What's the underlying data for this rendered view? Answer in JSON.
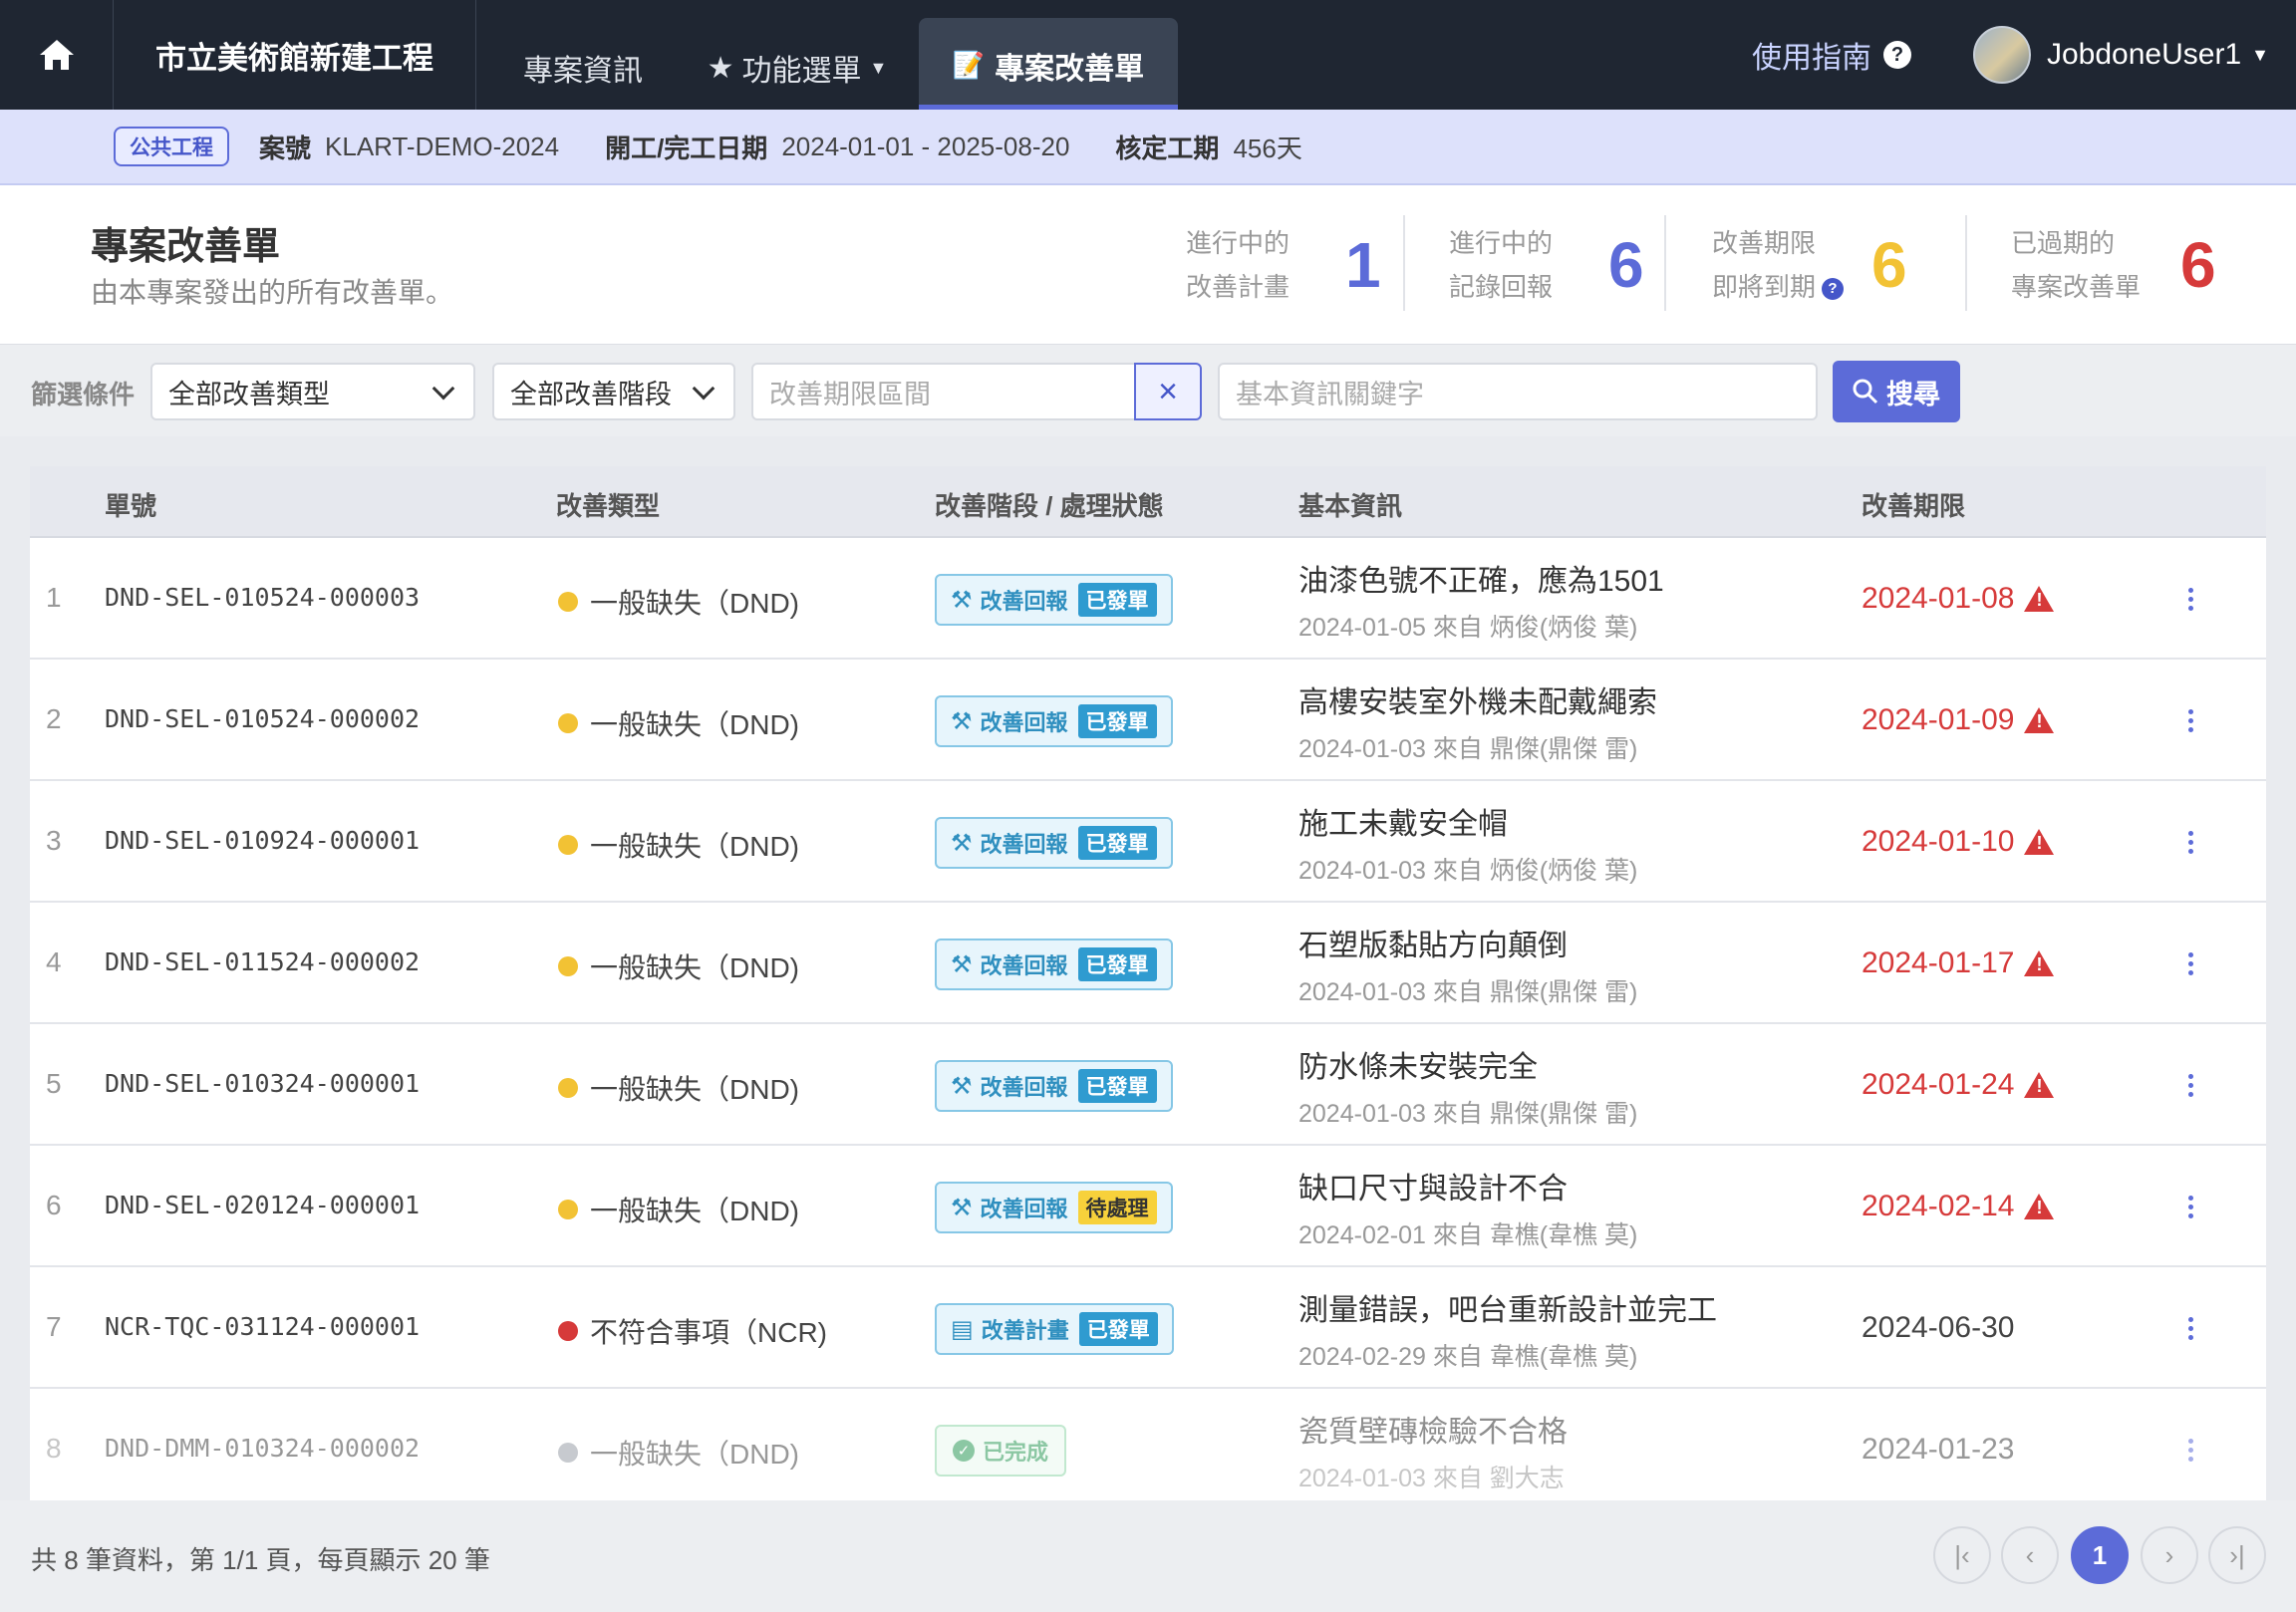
{
  "navbar": {
    "project": "市立美術館新建工程",
    "tabs": [
      {
        "label": "專案資訊",
        "icon": ""
      },
      {
        "label": "功能選單",
        "icon": "★"
      },
      {
        "label": "專案改善單",
        "icon": "📝"
      }
    ],
    "guide": "使用指南",
    "user": "JobdoneUser1"
  },
  "infobar": {
    "badge": "公共工程",
    "case_label": "案號",
    "case_value": "KLART-DEMO-2024",
    "date_label": "開工/完工日期",
    "date_value": "2024-01-01 - 2025-08-20",
    "duration_label": "核定工期",
    "duration_value": "456天"
  },
  "summary": {
    "title": "專案改善單",
    "subtitle": "由本專案發出的所有改善單。",
    "stats": [
      {
        "line1": "進行中的",
        "line2": "改善計畫",
        "value": "1",
        "color": "#5c6bd8"
      },
      {
        "line1": "進行中的",
        "line2": "記錄回報",
        "value": "6",
        "color": "#5c6bd8"
      },
      {
        "line1": "改善期限",
        "line2": "即將到期",
        "value": "6",
        "color": "#f2c234"
      },
      {
        "line1": "已過期的",
        "line2": "專案改善單",
        "value": "6",
        "color": "#d63a3a"
      }
    ]
  },
  "filters": {
    "label": "篩選條件",
    "type": "全部改善類型",
    "stage": "全部改善階段",
    "period_placeholder": "改善期限區間",
    "keyword_placeholder": "基本資訊關鍵字",
    "search": "搜尋"
  },
  "table": {
    "headers": [
      "單號",
      "改善類型",
      "改善階段 / 處理狀態",
      "基本資訊",
      "改善期限"
    ],
    "rows": [
      {
        "no": "1",
        "code": "DND-SEL-010524-000003",
        "type": "一般缺失（DND)",
        "dot": "#f2c234",
        "stage": "改善回報",
        "status": "已發單",
        "title": "油漆色號不正確，應為1501",
        "sub": "2024-01-05 來自 炳俊(炳俊 葉)",
        "deadline": "2024-01-08"
      },
      {
        "no": "2",
        "code": "DND-SEL-010524-000002",
        "type": "一般缺失（DND)",
        "dot": "#f2c234",
        "stage": "改善回報",
        "status": "已發單",
        "title": "高樓安裝室外機未配戴繩索",
        "sub": "2024-01-03 來自 鼎傑(鼎傑 雷)",
        "deadline": "2024-01-09"
      },
      {
        "no": "3",
        "code": "DND-SEL-010924-000001",
        "type": "一般缺失（DND)",
        "dot": "#f2c234",
        "stage": "改善回報",
        "status": "已發單",
        "title": "施工未戴安全帽",
        "sub": "2024-01-03 來自 炳俊(炳俊 葉)",
        "deadline": "2024-01-10"
      },
      {
        "no": "4",
        "code": "DND-SEL-011524-000002",
        "type": "一般缺失（DND)",
        "dot": "#f2c234",
        "stage": "改善回報",
        "status": "已發單",
        "title": "石塑版黏貼方向顛倒",
        "sub": "2024-01-03 來自 鼎傑(鼎傑 雷)",
        "deadline": "2024-01-17"
      },
      {
        "no": "5",
        "code": "DND-SEL-010324-000001",
        "type": "一般缺失（DND)",
        "dot": "#f2c234",
        "stage": "改善回報",
        "status": "已發單",
        "title": "防水條未安裝完全",
        "sub": "2024-01-03 來自 鼎傑(鼎傑 雷)",
        "deadline": "2024-01-24"
      },
      {
        "no": "6",
        "code": "DND-SEL-020124-000001",
        "type": "一般缺失（DND)",
        "dot": "#f2c234",
        "stage": "改善回報",
        "status": "待處理",
        "title": "缺口尺寸與設計不合",
        "sub": "2024-02-01 來自 韋樵(韋樵 莫)",
        "deadline": "2024-02-14"
      },
      {
        "no": "7",
        "code": "NCR-TQC-031124-000001",
        "type": "不符合事項（NCR)",
        "dot": "#d63a3a",
        "stage": "改善計畫",
        "status": "已發單",
        "title": "測量錯誤，吧台重新設計並完工",
        "sub": "2024-02-29 來自 韋樵(韋樵 莫)",
        "deadline": "2024-06-30"
      },
      {
        "no": "8",
        "code": "DND-DMM-010324-000002",
        "type": "一般缺失（DND)",
        "dot": "#9aa0a8",
        "stage": "已完成",
        "status": "",
        "title": "瓷質壁磚檢驗不合格",
        "sub": "2024-01-03 來自 劉大志",
        "deadline": "2024-01-23"
      }
    ]
  },
  "footer": {
    "text": "共 8 筆資料，第 1/1 頁，每頁顯示 20 筆",
    "page": "1"
  }
}
